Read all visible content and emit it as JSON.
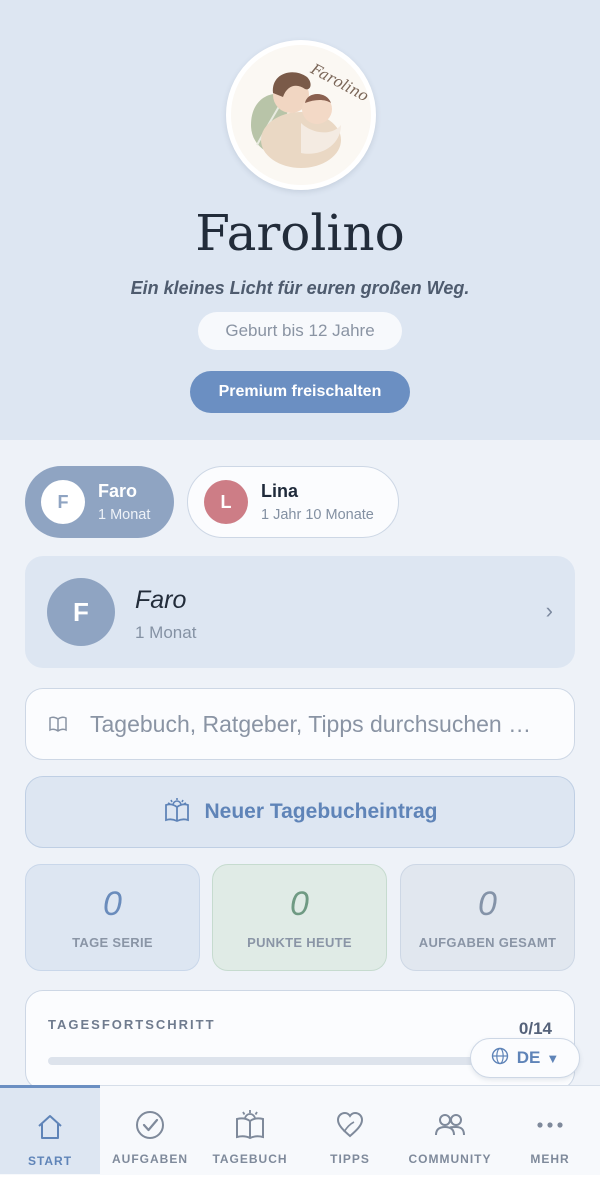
{
  "header": {
    "logo_text": "Farolino",
    "title": "Farolino",
    "tagline": "Ein kleines Licht für euren großen Weg.",
    "age_range": "Geburt bis 12 Jahre",
    "premium_label": "Premium freischalten"
  },
  "children": [
    {
      "initial": "F",
      "name": "Faro",
      "age": "1 Monat",
      "selected": true,
      "color": "#8fa4c2"
    },
    {
      "initial": "L",
      "name": "Lina",
      "age": "1 Jahr 10 Monate",
      "selected": false,
      "color": "#cd7d86"
    }
  ],
  "profile": {
    "initial": "F",
    "name": "Faro",
    "age": "1 Monat",
    "chevron": "›"
  },
  "search": {
    "placeholder": "Tagebuch, Ratgeber, Tipps durchsuchen …",
    "icon": "book-icon"
  },
  "new_entry": {
    "label": "Neuer Tagebucheintrag",
    "icon": "sunrise-book-icon"
  },
  "stats": [
    {
      "value": "0",
      "label": "TAGE SERIE"
    },
    {
      "value": "0",
      "label": "PUNKTE HEUTE"
    },
    {
      "value": "0",
      "label": "AUFGABEN GESAMT"
    }
  ],
  "progress": {
    "label": "TAGESFORTSCHRITT",
    "count": "0/14",
    "fraction": 0
  },
  "language": {
    "code": "DE",
    "caret": "▼",
    "icon": "globe-icon"
  },
  "nav": [
    {
      "label": "START",
      "icon": "home-icon",
      "active": true
    },
    {
      "label": "AUFGABEN",
      "icon": "check-circle-icon",
      "active": false
    },
    {
      "label": "TAGEBUCH",
      "icon": "journal-icon",
      "active": false
    },
    {
      "label": "TIPPS",
      "icon": "heart-leaf-icon",
      "active": false
    },
    {
      "label": "COMMUNITY",
      "icon": "people-icon",
      "active": false
    },
    {
      "label": "MEHR",
      "icon": "more-icon",
      "active": false
    }
  ],
  "colors": {
    "accent": "#6b8fc2",
    "header_bg": "#dde6f2",
    "page_bg": "#eef2f8",
    "lina": "#cd7d86"
  }
}
